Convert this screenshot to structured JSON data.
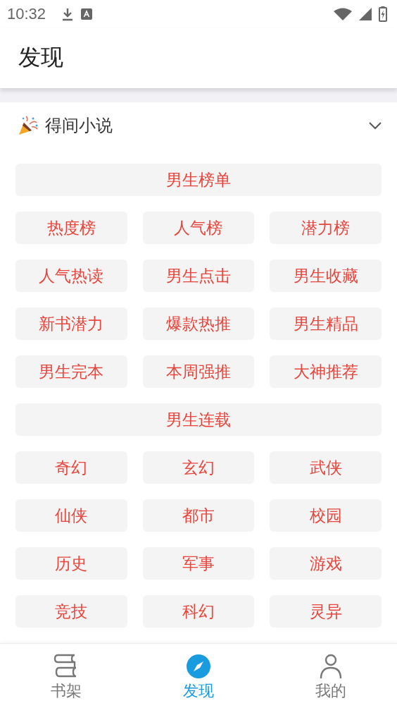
{
  "status_bar": {
    "time": "10:32"
  },
  "header": {
    "title": "发现"
  },
  "source": {
    "name": "得间小说",
    "expanded": true
  },
  "tags": [
    {
      "kind": "header",
      "label": "男生榜单"
    },
    {
      "kind": "tag",
      "label": "热度榜"
    },
    {
      "kind": "tag",
      "label": "人气榜"
    },
    {
      "kind": "tag",
      "label": "潜力榜"
    },
    {
      "kind": "tag",
      "label": "人气热读"
    },
    {
      "kind": "tag",
      "label": "男生点击"
    },
    {
      "kind": "tag",
      "label": "男生收藏"
    },
    {
      "kind": "tag",
      "label": "新书潜力"
    },
    {
      "kind": "tag",
      "label": "爆款热推"
    },
    {
      "kind": "tag",
      "label": "男生精品"
    },
    {
      "kind": "tag",
      "label": "男生完本"
    },
    {
      "kind": "tag",
      "label": "本周强推"
    },
    {
      "kind": "tag",
      "label": "大神推荐"
    },
    {
      "kind": "header",
      "label": "男生连载"
    },
    {
      "kind": "tag",
      "label": "奇幻"
    },
    {
      "kind": "tag",
      "label": "玄幻"
    },
    {
      "kind": "tag",
      "label": "武侠"
    },
    {
      "kind": "tag",
      "label": "仙侠"
    },
    {
      "kind": "tag",
      "label": "都市"
    },
    {
      "kind": "tag",
      "label": "校园"
    },
    {
      "kind": "tag",
      "label": "历史"
    },
    {
      "kind": "tag",
      "label": "军事"
    },
    {
      "kind": "tag",
      "label": "游戏"
    },
    {
      "kind": "tag",
      "label": "竞技"
    },
    {
      "kind": "tag",
      "label": "科幻"
    },
    {
      "kind": "tag",
      "label": "灵异"
    }
  ],
  "bottom_nav": [
    {
      "label": "书架",
      "kind": "books",
      "selected": false
    },
    {
      "label": "发现",
      "kind": "compass",
      "selected": true
    },
    {
      "label": "我的",
      "kind": "person",
      "selected": false
    }
  ]
}
